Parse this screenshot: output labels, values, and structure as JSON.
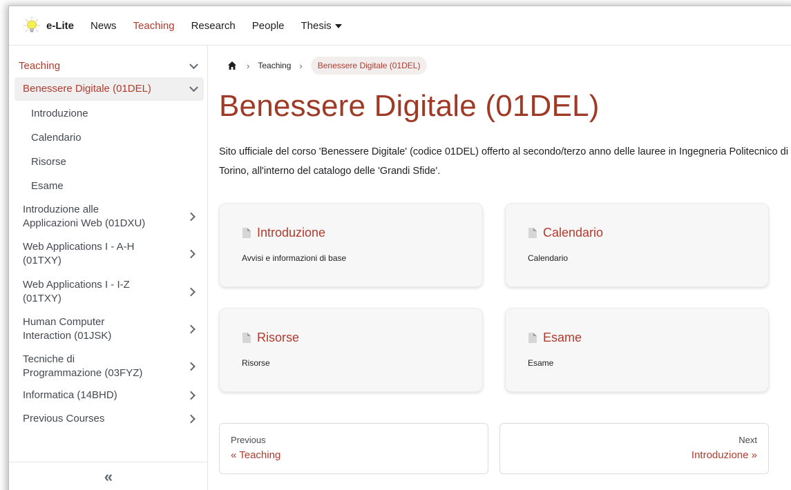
{
  "navbar": {
    "brand": "e-Lite",
    "links": [
      "News",
      "Teaching",
      "Research",
      "People"
    ],
    "thesis": "Thesis"
  },
  "sidebar": {
    "top": "Teaching",
    "current_course": "Benessere Digitale (01DEL)",
    "sub_items": [
      "Introduzione",
      "Calendario",
      "Risorse",
      "Esame"
    ],
    "courses": [
      [
        "Introduzione alle",
        "Applicazioni Web (01DXU)"
      ],
      [
        "Web Applications I - A-H",
        "(01TXY)"
      ],
      [
        "Web Applications I - I-Z",
        "(01TXY)"
      ],
      [
        "Human Computer",
        "Interaction (01JSK)"
      ],
      [
        "Tecniche di",
        "Programmazione (03FYZ)"
      ],
      [
        "Informatica (14BHD)"
      ],
      [
        "Previous Courses"
      ]
    ],
    "collapse": "«"
  },
  "breadcrumb": {
    "link": "Teaching",
    "current": "Benessere Digitale (01DEL)"
  },
  "main": {
    "title": "Benessere Digitale (01DEL)",
    "intro": "Sito ufficiale del corso 'Benessere Digitale' (codice 01DEL) offerto al secondo/terzo anno delle lauree in Ingegneria Politecnico di Torino, all'interno del catalogo delle 'Grandi Sfide'.",
    "cards": [
      {
        "title": "Introduzione",
        "desc": "Avvisi e informazioni di base"
      },
      {
        "title": "Calendario",
        "desc": "Calendario"
      },
      {
        "title": "Risorse",
        "desc": "Risorse"
      },
      {
        "title": "Esame",
        "desc": "Esame"
      }
    ]
  },
  "pager": {
    "prev_sub": "Previous",
    "prev_label": "« Teaching",
    "next_sub": "Next",
    "next_label": "Introduzione »"
  },
  "colors": {
    "accent": "#b03a2e",
    "title": "#9e3a26"
  }
}
